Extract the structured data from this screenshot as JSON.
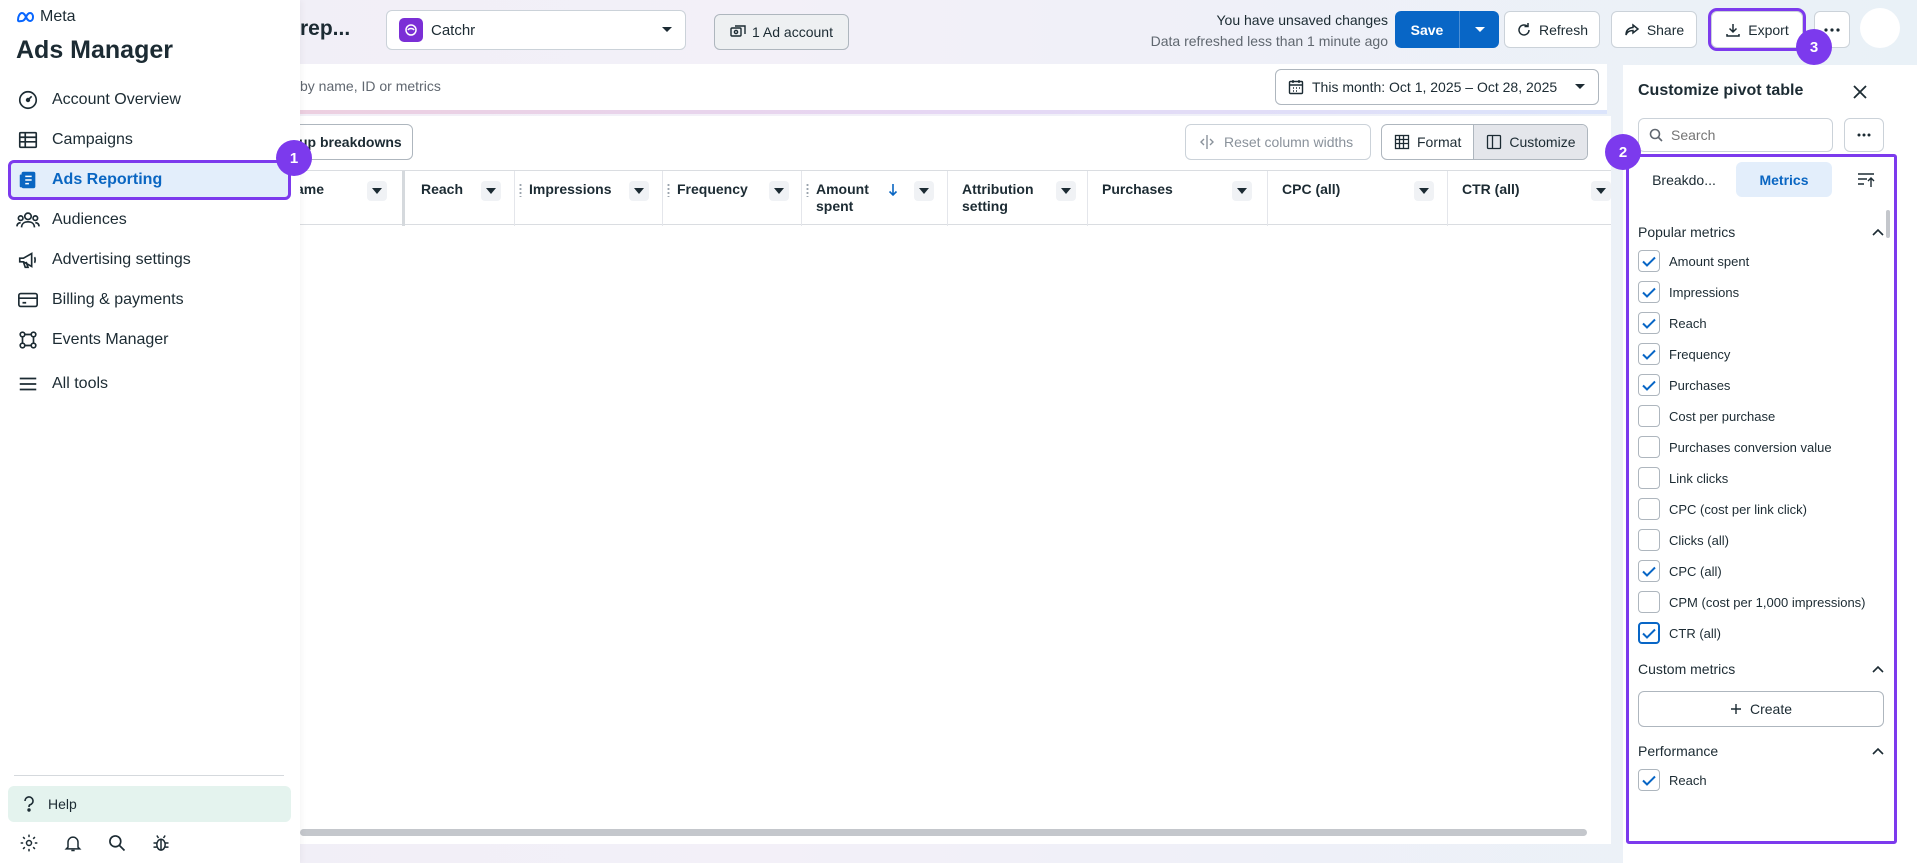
{
  "brand": {
    "meta": "Meta",
    "app": "Ads Manager"
  },
  "sidebar": {
    "items": [
      {
        "label": "Account Overview",
        "icon": "gauge-icon"
      },
      {
        "label": "Campaigns",
        "icon": "table-icon"
      },
      {
        "label": "Ads Reporting",
        "icon": "report-icon",
        "active": true
      },
      {
        "label": "Audiences",
        "icon": "people-icon"
      },
      {
        "label": "Advertising settings",
        "icon": "megaphone-icon"
      },
      {
        "label": "Billing & payments",
        "icon": "card-icon"
      },
      {
        "label": "Events Manager",
        "icon": "events-icon"
      },
      {
        "label": "All tools",
        "icon": "menu-icon"
      }
    ],
    "help": "Help"
  },
  "badges": {
    "b1": "1",
    "b2": "2",
    "b3": "3"
  },
  "accent": "#7c3aed",
  "topbar": {
    "page_title": "rep...",
    "account": "Catchr",
    "ad_account": "1 Ad account",
    "unsaved": "You have unsaved changes",
    "refreshed": "Data refreshed less than 1 minute ago",
    "save": "Save",
    "refresh": "Refresh",
    "share": "Share",
    "export": "Export"
  },
  "toolbar": {
    "search_placeholder": "by name, ID or metrics",
    "date_range": "This month: Oct 1, 2025 – Oct 28, 2025",
    "breakdowns": "up breakdowns",
    "reset": "Reset column widths",
    "format": "Format",
    "customize": "Customize"
  },
  "table": {
    "columns": [
      {
        "label": "ame"
      },
      {
        "label": "Reach"
      },
      {
        "label": "Impressions"
      },
      {
        "label": "Frequency"
      },
      {
        "label": "Amount spent"
      },
      {
        "label": "Attribution setting"
      },
      {
        "label": "Purchases"
      },
      {
        "label": "CPC (all)"
      },
      {
        "label": "CTR (all)"
      }
    ]
  },
  "panel": {
    "title": "Customize pivot table",
    "search_placeholder": "Search",
    "tabs": [
      "Breakdo...",
      "Metrics"
    ],
    "sections": {
      "popular": "Popular metrics",
      "custom": "Custom metrics",
      "performance": "Performance"
    },
    "popular_items": [
      {
        "label": "Amount spent",
        "checked": true
      },
      {
        "label": "Impressions",
        "checked": true
      },
      {
        "label": "Reach",
        "checked": true
      },
      {
        "label": "Frequency",
        "checked": true
      },
      {
        "label": "Purchases",
        "checked": true
      },
      {
        "label": "Cost per purchase",
        "checked": false
      },
      {
        "label": "Purchases conversion value",
        "checked": false
      },
      {
        "label": "Link clicks",
        "checked": false
      },
      {
        "label": "CPC (cost per link click)",
        "checked": false
      },
      {
        "label": "Clicks (all)",
        "checked": false
      },
      {
        "label": "CPC (all)",
        "checked": true
      },
      {
        "label": "CPM (cost per 1,000 impressions)",
        "checked": false
      },
      {
        "label": "CTR (all)",
        "checked": true
      }
    ],
    "create": "Create",
    "performance_items": [
      {
        "label": "Reach",
        "checked": true
      }
    ]
  }
}
